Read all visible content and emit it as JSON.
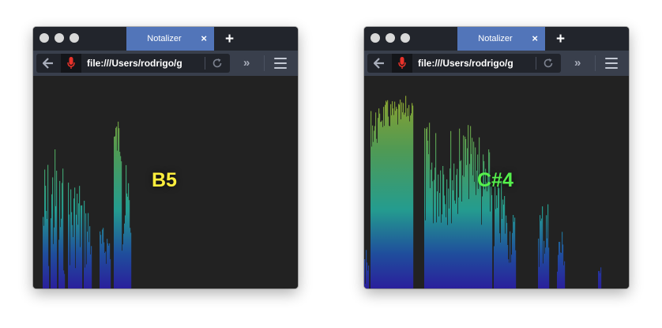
{
  "windows": [
    {
      "tab_title": "Notalizer",
      "tab_close": "×",
      "new_tab": "+",
      "url": "file:///Users/rodrigo/g",
      "more": "»",
      "note": "B5",
      "note_color": "#ffef3d"
    },
    {
      "tab_title": "Notalizer",
      "tab_close": "×",
      "new_tab": "+",
      "url": "file:///Users/rodrigo/g",
      "more": "»",
      "note": "C#4",
      "note_color": "#55f04c"
    }
  ],
  "colors": {
    "titlebar": "#22252c",
    "tab_active": "#5275b9",
    "navbar": "#393f4c",
    "content_bg": "#222222",
    "mic": "#e8322a",
    "spectrum_top": "#8fa12a",
    "spectrum_mid": "#249c8f",
    "spectrum_bottom": "#2a1f9c"
  }
}
